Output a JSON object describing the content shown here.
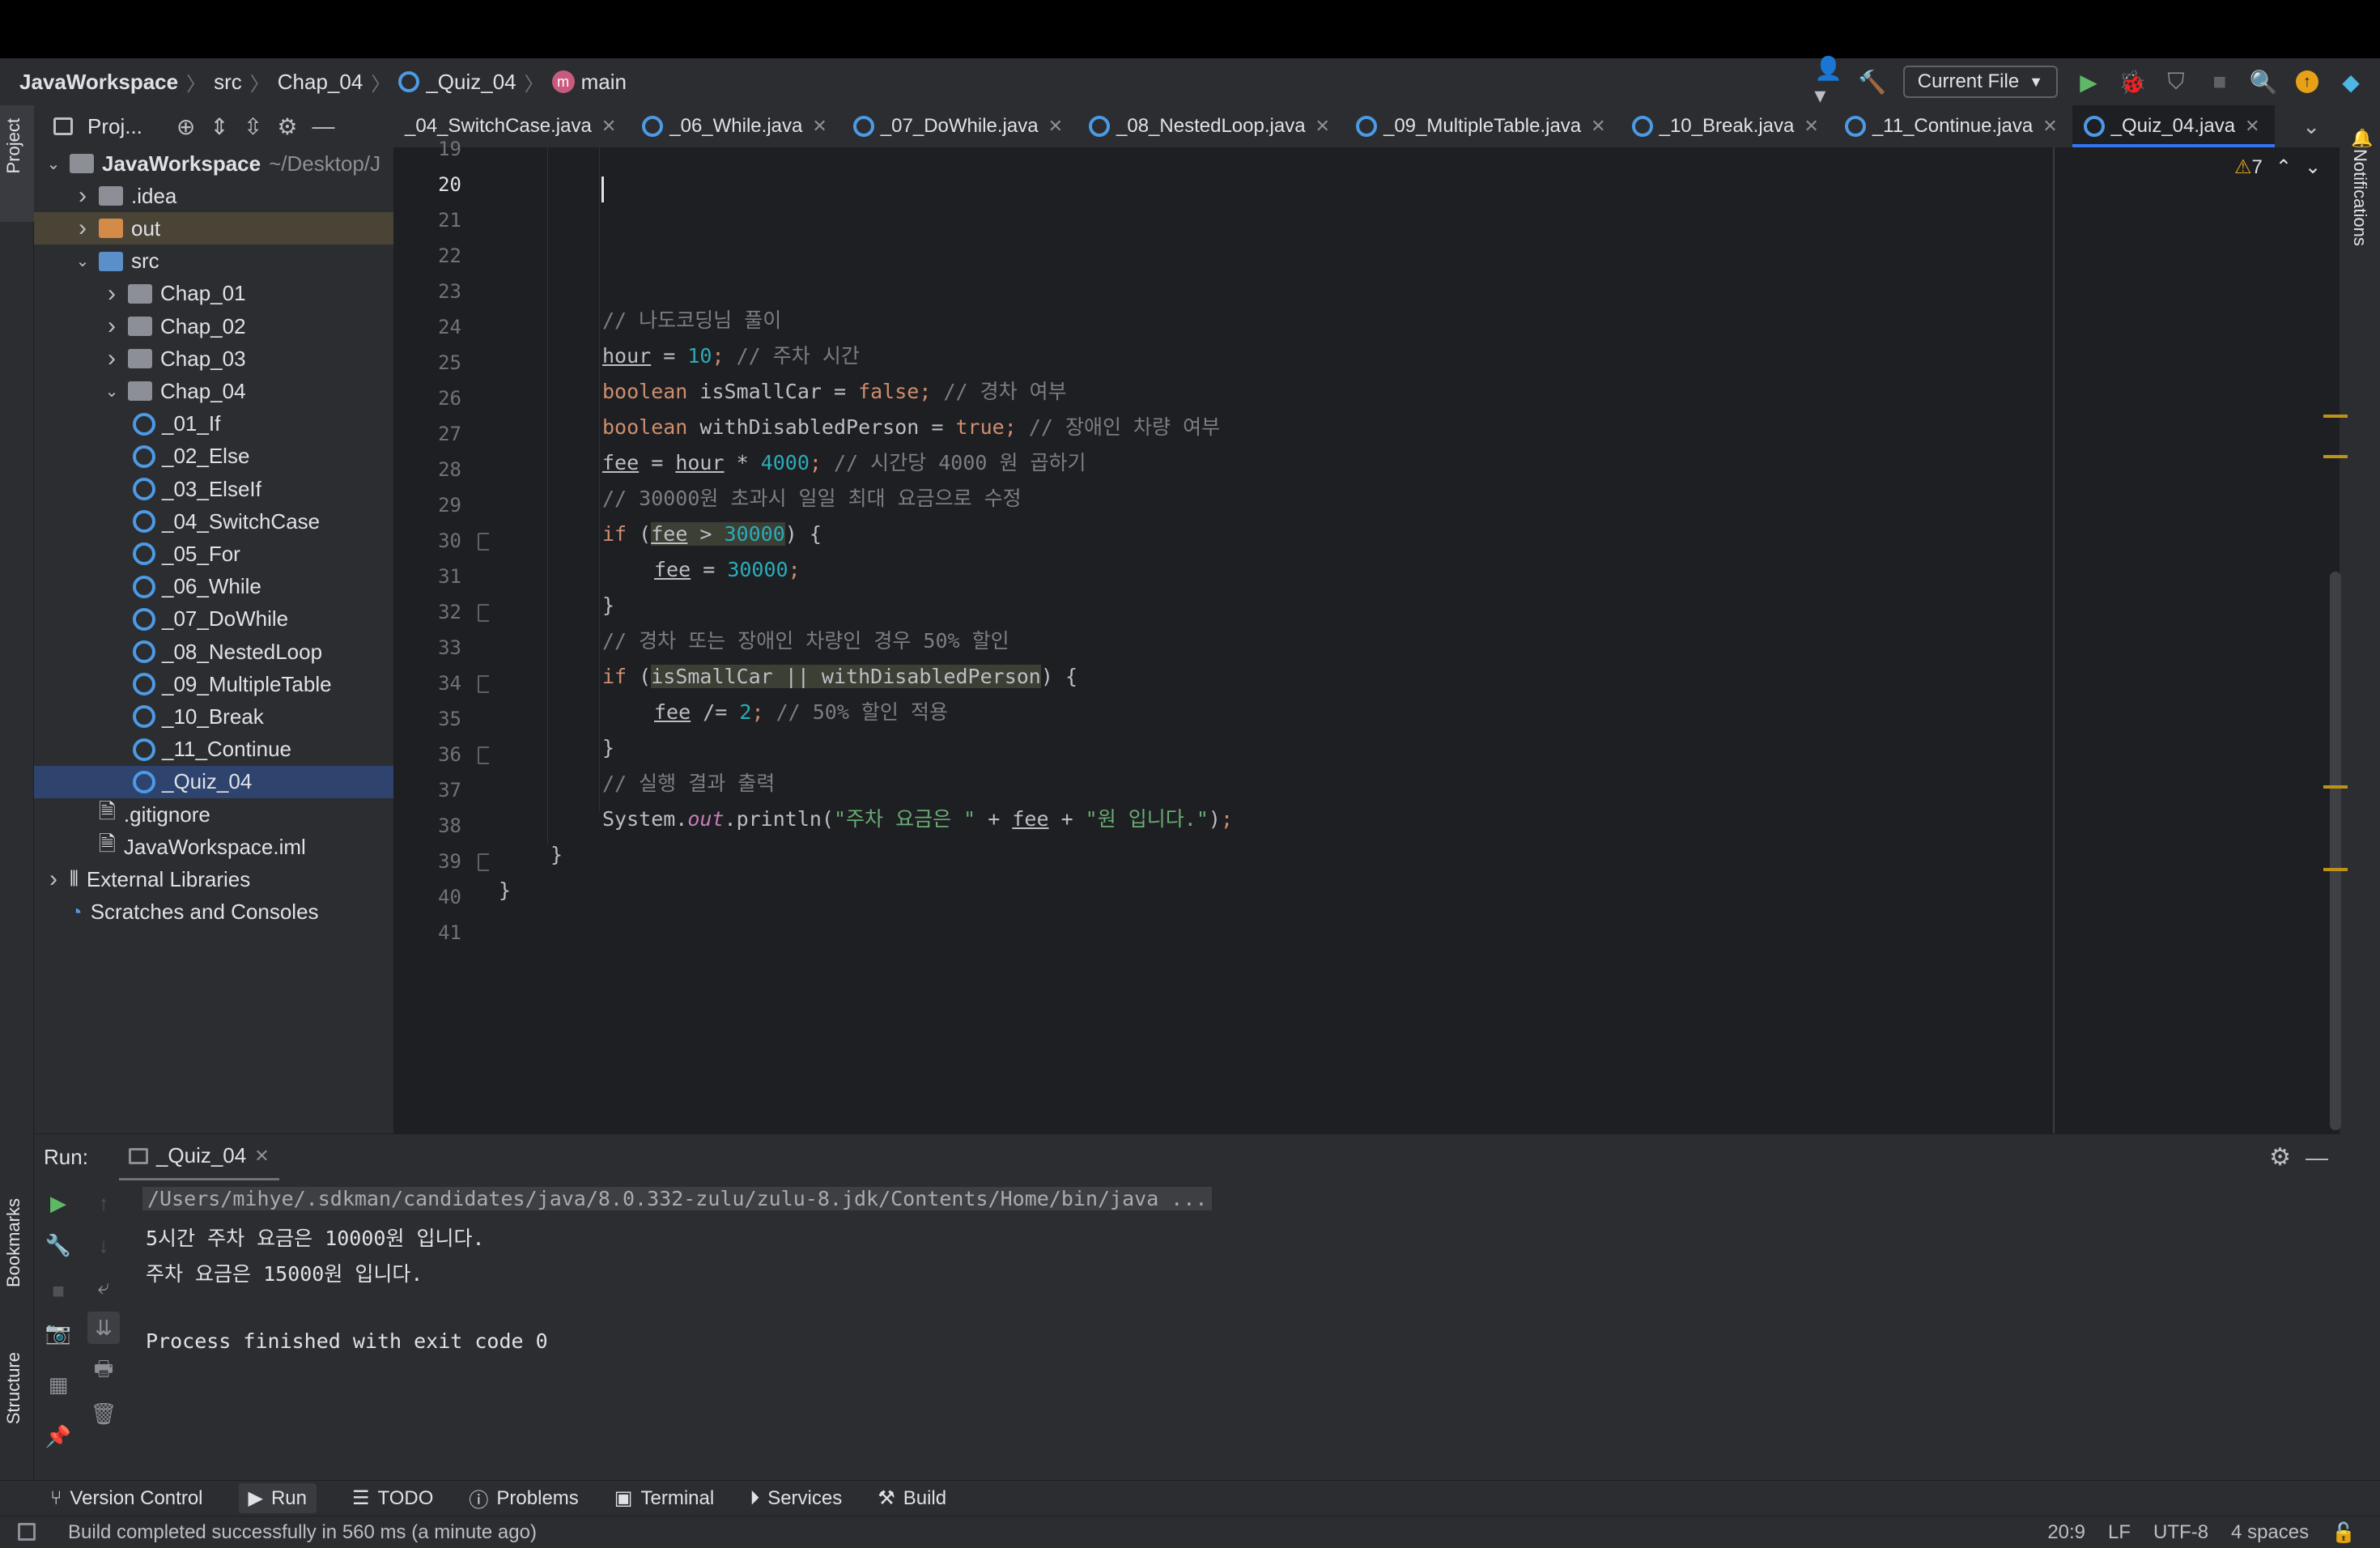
{
  "breadcrumb": [
    "JavaWorkspace",
    "src",
    "Chap_04",
    "_Quiz_04",
    "main"
  ],
  "run_config": "Current File",
  "project_panel": {
    "title": "Proj...",
    "tree": [
      {
        "label": "JavaWorkspace",
        "hint": "~/Desktop/J",
        "depth": 0,
        "chev": "v",
        "icon": "module"
      },
      {
        "label": ".idea",
        "depth": 1,
        "chev": ">",
        "icon": "folder-grey"
      },
      {
        "label": "out",
        "depth": 1,
        "chev": ">",
        "icon": "folder-orange"
      },
      {
        "label": "src",
        "depth": 1,
        "chev": "v",
        "icon": "folder"
      },
      {
        "label": "Chap_01",
        "depth": 2,
        "chev": ">",
        "icon": "package"
      },
      {
        "label": "Chap_02",
        "depth": 2,
        "chev": ">",
        "icon": "package"
      },
      {
        "label": "Chap_03",
        "depth": 2,
        "chev": ">",
        "icon": "package"
      },
      {
        "label": "Chap_04",
        "depth": 2,
        "chev": "v",
        "icon": "package"
      },
      {
        "label": "_01_If",
        "depth": 3,
        "icon": "class"
      },
      {
        "label": "_02_Else",
        "depth": 3,
        "icon": "class"
      },
      {
        "label": "_03_ElseIf",
        "depth": 3,
        "icon": "class"
      },
      {
        "label": "_04_SwitchCase",
        "depth": 3,
        "icon": "class"
      },
      {
        "label": "_05_For",
        "depth": 3,
        "icon": "class"
      },
      {
        "label": "_06_While",
        "depth": 3,
        "icon": "class"
      },
      {
        "label": "_07_DoWhile",
        "depth": 3,
        "icon": "class"
      },
      {
        "label": "_08_NestedLoop",
        "depth": 3,
        "icon": "class"
      },
      {
        "label": "_09_MultipleTable",
        "depth": 3,
        "icon": "class"
      },
      {
        "label": "_10_Break",
        "depth": 3,
        "icon": "class"
      },
      {
        "label": "_11_Continue",
        "depth": 3,
        "icon": "class"
      },
      {
        "label": "_Quiz_04",
        "depth": 3,
        "icon": "class",
        "selected": true
      },
      {
        "label": ".gitignore",
        "depth": 1,
        "icon": "file"
      },
      {
        "label": "JavaWorkspace.iml",
        "depth": 1,
        "icon": "file"
      },
      {
        "label": "External Libraries",
        "depth": 0,
        "chev": ">",
        "icon": "libs"
      },
      {
        "label": "Scratches and Consoles",
        "depth": 0,
        "icon": "scratch"
      }
    ]
  },
  "tabs": [
    {
      "label": "_04_SwitchCase.java"
    },
    {
      "label": "_06_While.java"
    },
    {
      "label": "_07_DoWhile.java"
    },
    {
      "label": "_08_NestedLoop.java"
    },
    {
      "label": "_09_MultipleTable.java"
    },
    {
      "label": "_10_Break.java"
    },
    {
      "label": "_11_Continue.java"
    },
    {
      "label": "_Quiz_04.java",
      "active": true
    }
  ],
  "warnings_count": "7",
  "editor": {
    "line_numbers": [
      "19",
      "20",
      "21",
      "22",
      "23",
      "24",
      "25",
      "26",
      "27",
      "28",
      "29",
      "30",
      "31",
      "32",
      "33",
      "34",
      "35",
      "36",
      "37",
      "38",
      "39",
      "40",
      "41"
    ],
    "current_line": "20"
  },
  "run_panel": {
    "label": "Run:",
    "tab": "_Quiz_04",
    "console": [
      "/Users/mihye/.sdkman/candidates/java/8.0.332-zulu/zulu-8.jdk/Contents/Home/bin/java ...",
      "5시간 주차 요금은 10000원 입니다.",
      "주차 요금은 15000원 입니다.",
      "",
      "Process finished with exit code 0"
    ]
  },
  "tool_windows": [
    "Version Control",
    "Run",
    "TODO",
    "Problems",
    "Terminal",
    "Services",
    "Build"
  ],
  "side_labels": {
    "project": "Project",
    "bookmarks": "Bookmarks",
    "structure": "Structure",
    "notifications": "Notifications"
  },
  "status": {
    "message": "Build completed successfully in 560 ms (a minute ago)",
    "position": "20:9",
    "line_ending": "LF",
    "encoding": "UTF-8",
    "indent": "4 spaces"
  },
  "colors": {
    "accent": "#3574f0",
    "warning": "#be9117",
    "run_green": "#5fb865"
  }
}
